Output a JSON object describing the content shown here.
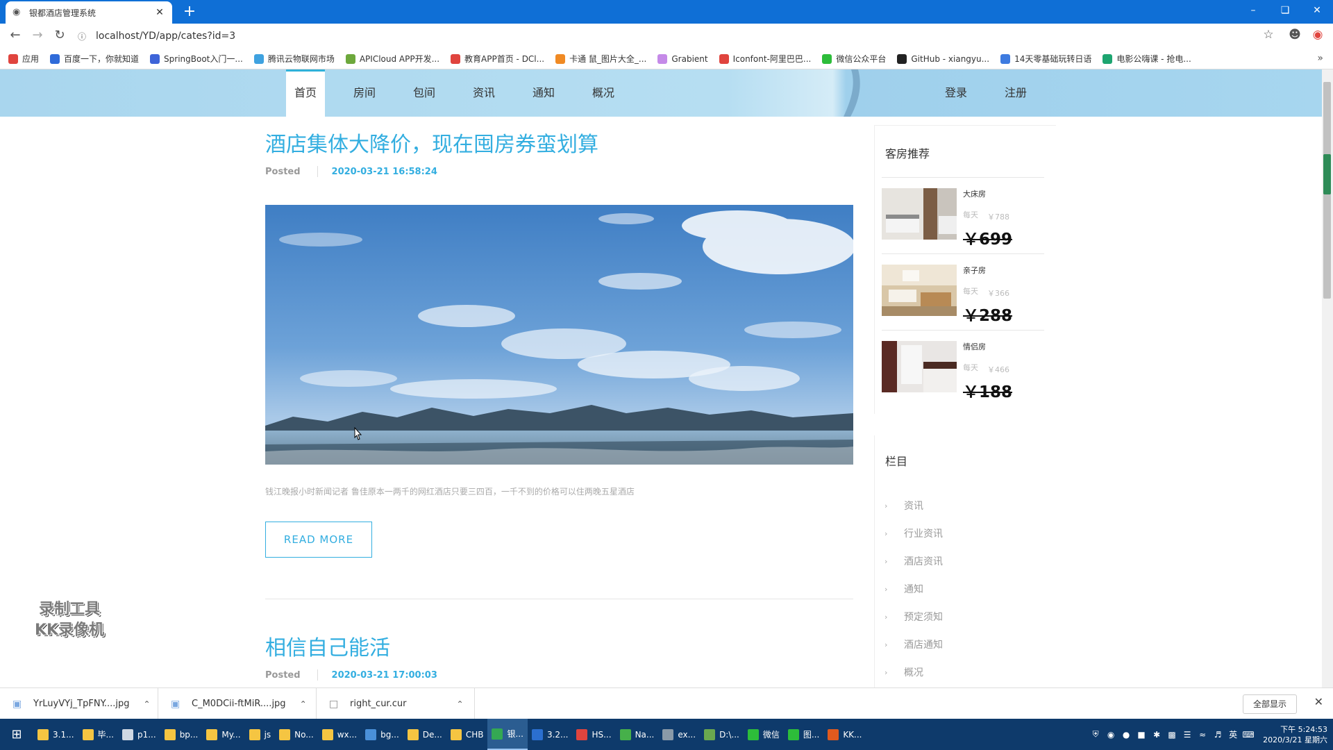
{
  "browser": {
    "tab_title": "银都酒店管理系统",
    "new_tab": "+",
    "url": "localhost/YD/app/cates?id=3",
    "bookmarks": [
      {
        "label": "应用",
        "color": "#e0443e"
      },
      {
        "label": "百度一下，你就知道",
        "color": "#2f6bd9"
      },
      {
        "label": "SpringBoot入门一...",
        "color": "#3e64d8"
      },
      {
        "label": "腾讯云物联网市场",
        "color": "#3fa2e0"
      },
      {
        "label": "APICloud APP开发...",
        "color": "#6da83c"
      },
      {
        "label": "教育APP首页 - DCl...",
        "color": "#e0443e"
      },
      {
        "label": "卡通 鼠_图片大全_...",
        "color": "#f08a24"
      },
      {
        "label": "Grabient",
        "color": "#c58ae8"
      },
      {
        "label": "Iconfont-阿里巴巴...",
        "color": "#e0443e"
      },
      {
        "label": "微信公众平台",
        "color": "#2dbd3a"
      },
      {
        "label": "GitHub - xiangyu...",
        "color": "#222222"
      },
      {
        "label": "14天零基础玩转日语",
        "color": "#3e7be0"
      },
      {
        "label": "电影公嗨课 - 抢电...",
        "color": "#1da570"
      }
    ],
    "more": "»"
  },
  "site": {
    "nav": [
      "首页",
      "房间",
      "包间",
      "资讯",
      "通知",
      "概况"
    ],
    "login": "登录",
    "register": "注册"
  },
  "posts": [
    {
      "title": "酒店集体大降价，现在囤房券蛮划算",
      "posted": "Posted",
      "date": "2020-03-21 16:58:24",
      "excerpt": "钱江晚报小时新闻记者 鲁佳原本一两千的网红酒店只要三四百，一千不到的价格可以住两晚五星酒店",
      "read_more": "READ MORE"
    },
    {
      "title": "相信自己能活",
      "posted": "Posted",
      "date": "2020-03-21 17:00:03"
    }
  ],
  "sidebar": {
    "rooms_title": "客房推荐",
    "rooms": [
      {
        "name": "大床房",
        "per": "每天",
        "old": "￥788",
        "price": "￥699"
      },
      {
        "name": "亲子房",
        "per": "每天",
        "old": "￥366",
        "price": "￥288"
      },
      {
        "name": "情侣房",
        "per": "每天",
        "old": "￥466",
        "price": "￥188"
      }
    ],
    "cats_title": "栏目",
    "categories": [
      "资讯",
      "行业资讯",
      "酒店资讯",
      "通知",
      "预定须知",
      "酒店通知",
      "概况"
    ]
  },
  "watermark": [
    "录制工具",
    "KK录像机"
  ],
  "downloads": {
    "files": [
      "YrLuyVYj_TpFNY....jpg",
      "C_M0DCii-ftMiR....jpg",
      "right_cur.cur"
    ],
    "show_all": "全部显示"
  },
  "taskbar": {
    "items": [
      {
        "label": "3.1...",
        "color": "#f5c542"
      },
      {
        "label": "毕...",
        "color": "#f5c542"
      },
      {
        "label": "p1...",
        "color": "#cfd8e3"
      },
      {
        "label": "bp...",
        "color": "#f5c542"
      },
      {
        "label": "My...",
        "color": "#f5c542"
      },
      {
        "label": "js",
        "color": "#f5c542"
      },
      {
        "label": "No...",
        "color": "#f5c542"
      },
      {
        "label": "wx...",
        "color": "#f5c542"
      },
      {
        "label": "bg...",
        "color": "#4a90d9"
      },
      {
        "label": "De...",
        "color": "#f5c542"
      },
      {
        "label": "CHB",
        "color": "#f5c542"
      },
      {
        "label": "银...",
        "color": "#34a853"
      },
      {
        "label": "3.2...",
        "color": "#2b6fd0"
      },
      {
        "label": "HS...",
        "color": "#e0443e"
      },
      {
        "label": "Na...",
        "color": "#46b04a"
      },
      {
        "label": "ex...",
        "color": "#8a9aa8"
      },
      {
        "label": "D:\\...",
        "color": "#6aa84f"
      },
      {
        "label": "微信",
        "color": "#2dbd3a"
      },
      {
        "label": "图...",
        "color": "#2dbd3a"
      },
      {
        "label": "KK...",
        "color": "#e05a1e"
      }
    ],
    "ime": "英",
    "time": "下午 5:24:53",
    "date": "2020/3/21 星期六"
  }
}
